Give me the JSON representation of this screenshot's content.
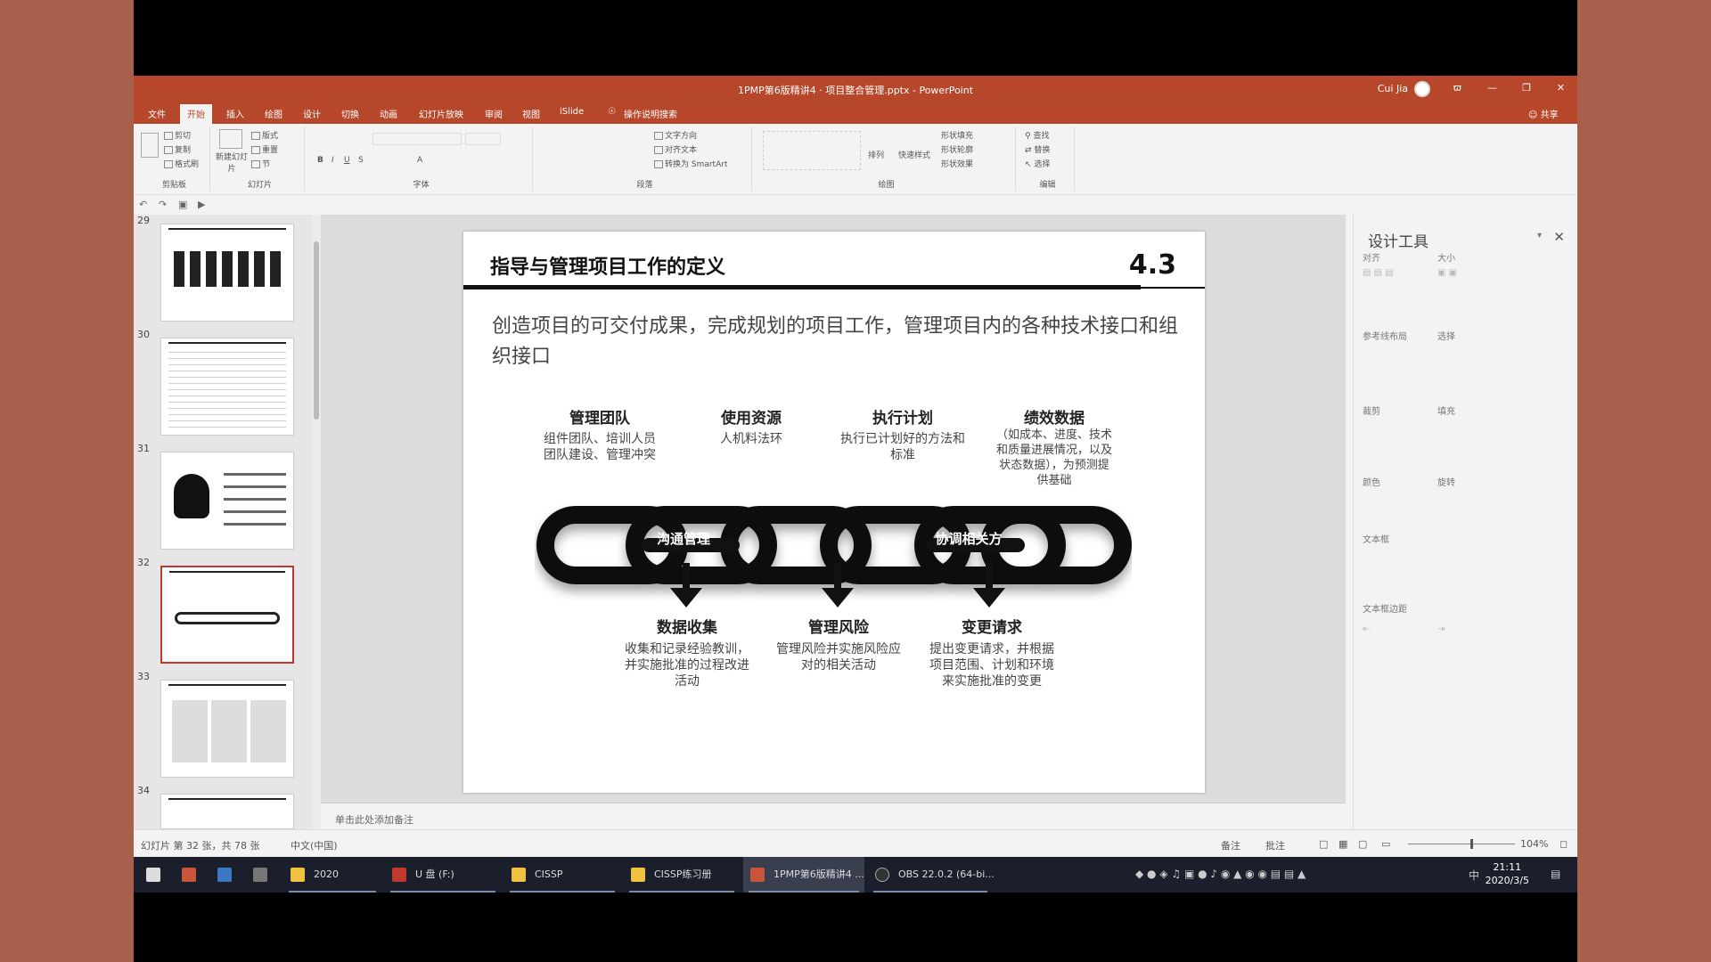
{
  "window": {
    "title": "1PMP第6版精讲4 · 项目整合管理.pptx - PowerPoint",
    "user": "Cui Jia",
    "controls": [
      "ϖ",
      "—",
      "❐",
      "✕"
    ]
  },
  "ribbon_tabs": [
    "文件",
    "开始",
    "插入",
    "绘图",
    "设计",
    "切换",
    "动画",
    "幻灯片放映",
    "审阅",
    "视图",
    "iSlide",
    "操作说明搜索"
  ],
  "share_label": "共享",
  "ribbon": {
    "clipboard": {
      "label": "剪贴板",
      "items": [
        "剪切",
        "复制",
        "格式刷"
      ]
    },
    "slides": {
      "label": "幻灯片",
      "new_slide": "新建幻灯片",
      "items": [
        "版式",
        "重置",
        "节"
      ]
    },
    "font": {
      "label": "字体"
    },
    "paragraph": {
      "label": "段落",
      "items": [
        "文字方向",
        "对齐文本",
        "转换为 SmartArt"
      ]
    },
    "drawing": {
      "label": "绘图",
      "items": [
        "排列",
        "快速样式",
        "形状填充",
        "形状轮廓",
        "形状效果"
      ]
    },
    "editing": {
      "label": "编辑",
      "items": [
        "查找",
        "替换",
        "选择"
      ]
    }
  },
  "thumbnails": [
    {
      "num": "29"
    },
    {
      "num": "30"
    },
    {
      "num": "31"
    },
    {
      "num": "32",
      "selected": true
    },
    {
      "num": "33"
    },
    {
      "num": "34"
    }
  ],
  "slide": {
    "title": "指导与管理项目工作的定义",
    "number": "4.3",
    "description": "创造项目的可交付成果，完成规划的项目工作，管理项目内的各种技术接口和组织接口",
    "top_columns": [
      {
        "heading": "管理团队",
        "text": "组件团队、培训人员\n团队建设、管理冲突"
      },
      {
        "heading": "使用资源",
        "text": "人机料法环"
      },
      {
        "heading": "执行计划",
        "text": "执行已计划好的方法和标准"
      },
      {
        "heading": "绩效数据",
        "text": "（如成本、进度、技术和质量进展情况，以及状态数据），为预测提供基础"
      }
    ],
    "chain_labels": [
      "沟通管理",
      "协调相关方"
    ],
    "bottom_columns": [
      {
        "heading": "数据收集",
        "text": "收集和记录经验教训，并实施批准的过程改进活动"
      },
      {
        "heading": "管理风险",
        "text": "管理风险并实施风险应对的相关活动"
      },
      {
        "heading": "变更请求",
        "text": "提出变更请求，并根据项目范围、计划和环境来实施批准的变更"
      }
    ]
  },
  "notes_placeholder": "单击此处添加备注",
  "design_pane": {
    "title": "设计工具",
    "labels": [
      "对齐",
      "大小",
      "参考线布局",
      "选择",
      "裁剪",
      "填充",
      "颜色",
      "旋转",
      "文本框",
      "文本框边距"
    ]
  },
  "status_bar": {
    "slide_info": "幻灯片 第 32 张，共 78 张",
    "language": "中文(中国)",
    "notes": "备注",
    "comments": "批注",
    "zoom": "104%"
  },
  "taskbar": {
    "items": [
      "2020",
      "U 盘 (F:)",
      "CISSP",
      "CISSP练习册",
      "1PMP第6版精讲4 ...",
      "OBS 22.0.2 (64-bi..."
    ],
    "tray_lang": "中",
    "time": "21:11",
    "date": "2020/3/5"
  },
  "colors": {
    "accent": "#b7472a",
    "selection": "#c0392b"
  }
}
